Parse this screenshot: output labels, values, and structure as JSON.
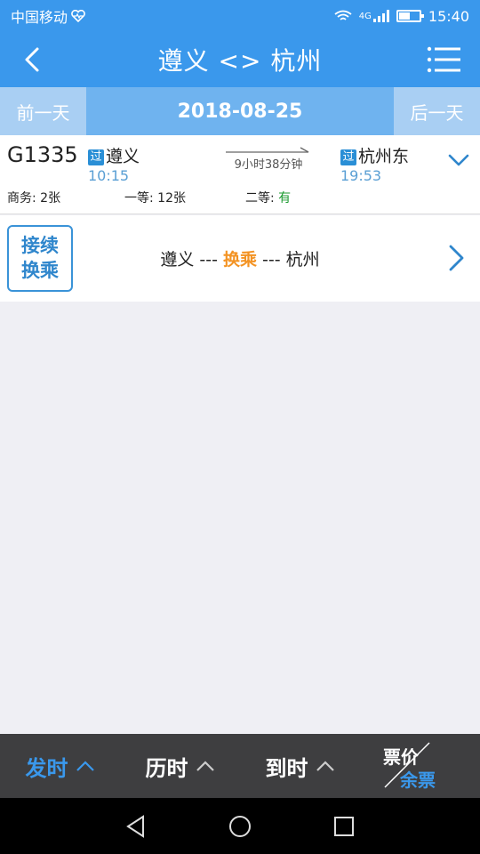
{
  "status_bar": {
    "carrier": "中国移动",
    "network": "4G",
    "time": "15:40",
    "battery_level": 0.55
  },
  "header": {
    "title": "遵义 <> 杭州"
  },
  "date_bar": {
    "prev_label": "前一天",
    "date": "2018-08-25",
    "next_label": "后一天"
  },
  "train": {
    "code": "G1335",
    "from_badge": "过",
    "from_station": "遵义",
    "from_time": "10:15",
    "duration": "9小时38分钟",
    "to_badge": "过",
    "to_station": "杭州东",
    "to_time": "19:53",
    "seats": [
      {
        "label": "商务: ",
        "value": "2张"
      },
      {
        "label": "一等: ",
        "value": "12张"
      },
      {
        "label": "二等: ",
        "value": "有"
      }
    ]
  },
  "transfer": {
    "box_line1": "接续",
    "box_line2": "换乘",
    "route_from": "遵义 --- ",
    "route_mid": "换乘",
    "route_to": " --- 杭州"
  },
  "bottom_bar": {
    "sort_depart": "发时",
    "sort_duration": "历时",
    "sort_arrive": "到时",
    "price_label": "票价",
    "remain_label": "余票"
  },
  "colors": {
    "brand": "#3a98ec",
    "accent_orange": "#f39323",
    "available_green": "#1b9a2f"
  }
}
